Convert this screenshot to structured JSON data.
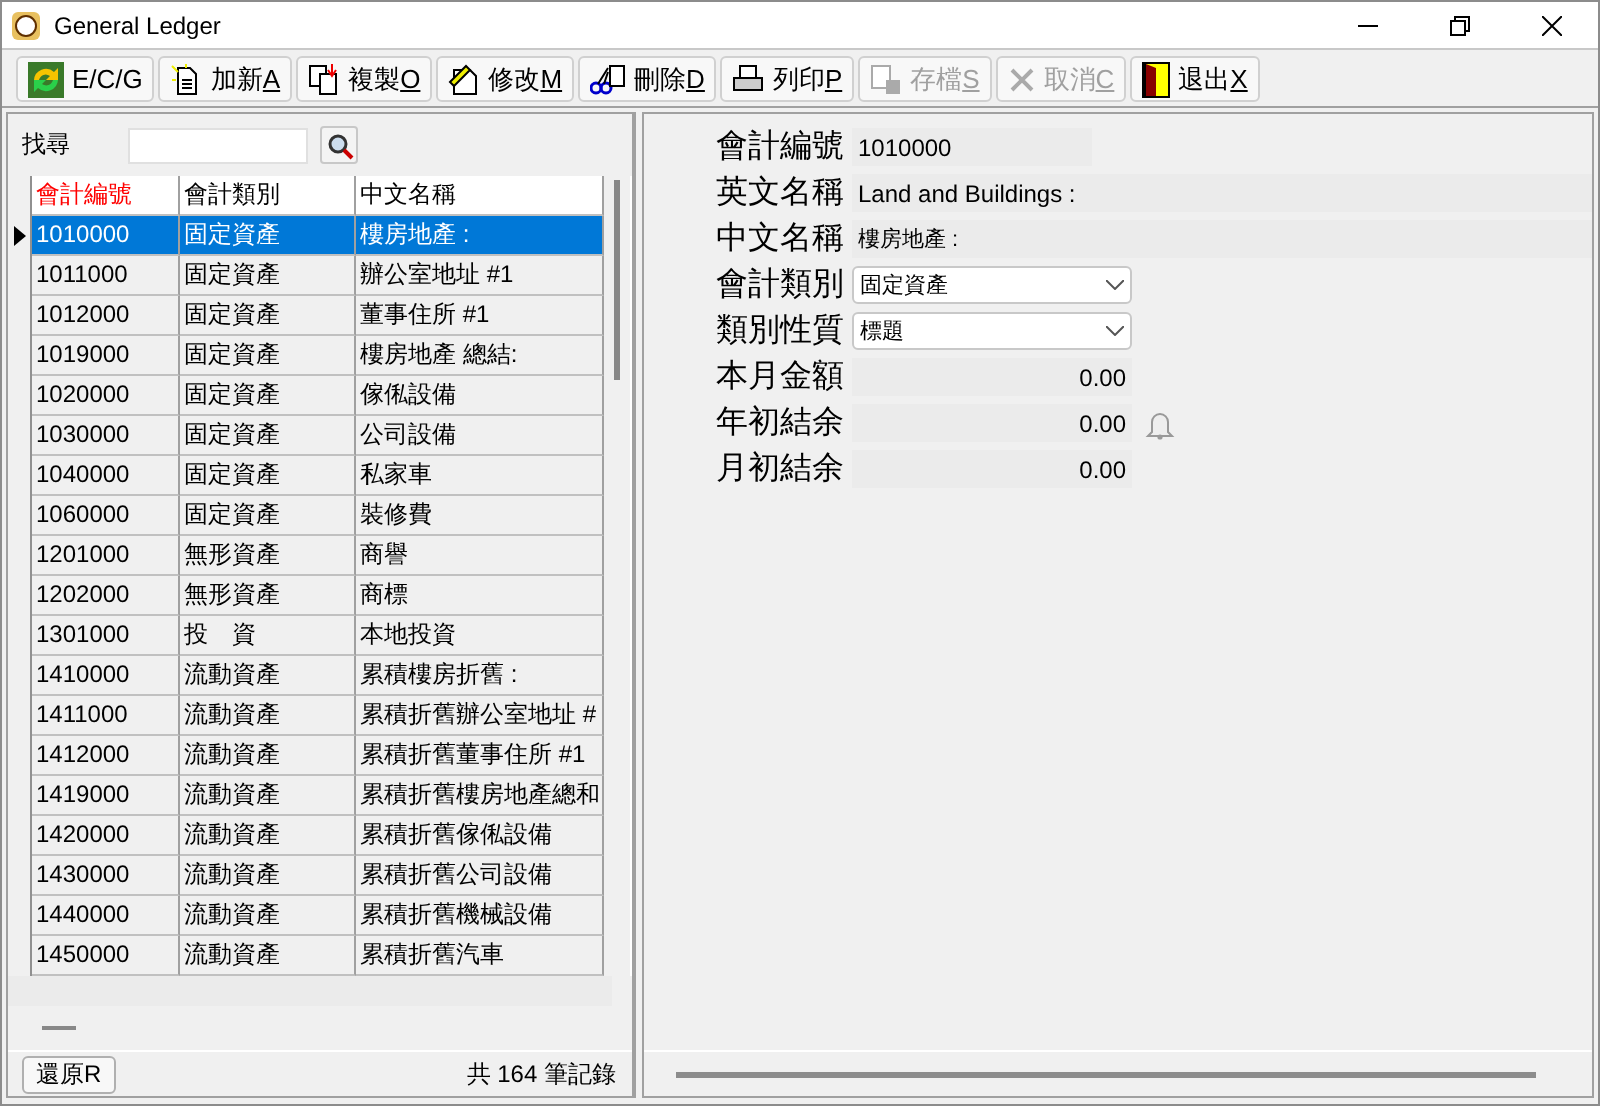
{
  "window": {
    "title": "General Ledger"
  },
  "toolbar": [
    {
      "label": "E/C/G",
      "kind": "ecg",
      "disabled": false
    },
    {
      "label": "加新",
      "key": "A",
      "kind": "add",
      "disabled": false
    },
    {
      "label": "複製",
      "key": "O",
      "kind": "copy",
      "disabled": false
    },
    {
      "label": "修改",
      "key": "M",
      "kind": "edit",
      "disabled": false
    },
    {
      "label": "刪除",
      "key": "D",
      "kind": "delete",
      "disabled": false
    },
    {
      "label": "列印",
      "key": "P",
      "kind": "print",
      "disabled": false
    },
    {
      "label": "存檔",
      "key": "S",
      "kind": "save",
      "disabled": true
    },
    {
      "label": "取消",
      "key": "C",
      "kind": "cancel",
      "disabled": true
    },
    {
      "label": "退出",
      "key": "X",
      "kind": "exit",
      "disabled": false
    }
  ],
  "search": {
    "label": "找尋"
  },
  "table": {
    "columns": [
      {
        "label": "會計編號",
        "sorted": true
      },
      {
        "label": "會計類別",
        "sorted": false
      },
      {
        "label": "中文名稱",
        "sorted": false
      }
    ],
    "rows": [
      {
        "cells": [
          "1010000",
          "固定資產",
          "樓房地產 :"
        ],
        "selected": true
      },
      {
        "cells": [
          "1011000",
          "固定資產",
          "辦公室地址 #1"
        ],
        "selected": false
      },
      {
        "cells": [
          "1012000",
          "固定資產",
          "董事住所 #1"
        ],
        "selected": false
      },
      {
        "cells": [
          "1019000",
          "固定資產",
          "樓房地產 總結:"
        ],
        "selected": false
      },
      {
        "cells": [
          "1020000",
          "固定資產",
          "傢俬設備"
        ],
        "selected": false
      },
      {
        "cells": [
          "1030000",
          "固定資產",
          "公司設備"
        ],
        "selected": false
      },
      {
        "cells": [
          "1040000",
          "固定資產",
          "私家車"
        ],
        "selected": false
      },
      {
        "cells": [
          "1060000",
          "固定資產",
          "裝修費"
        ],
        "selected": false
      },
      {
        "cells": [
          "1201000",
          "無形資產",
          "商譽"
        ],
        "selected": false
      },
      {
        "cells": [
          "1202000",
          "無形資產",
          "商標"
        ],
        "selected": false
      },
      {
        "cells": [
          "1301000",
          "投　資",
          "本地投資"
        ],
        "selected": false
      },
      {
        "cells": [
          "1410000",
          "流動資產",
          "累積樓房折舊 :"
        ],
        "selected": false
      },
      {
        "cells": [
          "1411000",
          "流動資產",
          "累積折舊辦公室地址 #"
        ],
        "selected": false
      },
      {
        "cells": [
          "1412000",
          "流動資產",
          "累積折舊董事住所 #1"
        ],
        "selected": false
      },
      {
        "cells": [
          "1419000",
          "流動資產",
          "累積折舊樓房地產總和"
        ],
        "selected": false
      },
      {
        "cells": [
          "1420000",
          "流動資產",
          "累積折舊傢俬設備"
        ],
        "selected": false
      },
      {
        "cells": [
          "1430000",
          "流動資產",
          "累積折舊公司設備"
        ],
        "selected": false
      },
      {
        "cells": [
          "1440000",
          "流動資產",
          "累積折舊機械設備"
        ],
        "selected": false
      },
      {
        "cells": [
          "1450000",
          "流動資產",
          "累積折舊汽車"
        ],
        "selected": false
      }
    ]
  },
  "footer": {
    "restore": {
      "label": "還原",
      "key": "R"
    },
    "count": "共 164 筆記錄"
  },
  "form": [
    {
      "label": "會計編號",
      "kind": "code",
      "value": "1010000"
    },
    {
      "label": "英文名稱",
      "kind": "text",
      "value": "Land and Buildings :"
    },
    {
      "label": "中文名稱",
      "kind": "text",
      "value": "樓房地產 :"
    },
    {
      "label": "會計類別",
      "kind": "select",
      "value": "固定資產"
    },
    {
      "label": "類別性質",
      "kind": "select",
      "value": "標題"
    },
    {
      "label": "本月金額",
      "kind": "amount",
      "value": "0.00",
      "alert": false
    },
    {
      "label": "年初結余",
      "kind": "amount",
      "value": "0.00",
      "alert": true
    },
    {
      "label": "月初結余",
      "kind": "amount",
      "value": "0.00",
      "alert": false
    }
  ]
}
